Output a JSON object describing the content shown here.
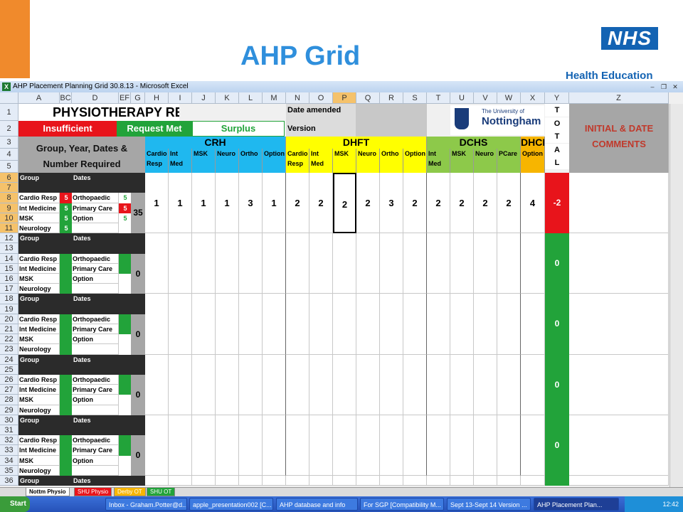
{
  "slide": {
    "title": "AHP Grid",
    "nhs_logo": "NHS",
    "nhs_subtitle": "Health Education"
  },
  "window": {
    "title": "AHP Placement Planning Grid 30.8.13 - Microsoft Excel"
  },
  "columns": [
    "A",
    "BC",
    "D",
    "EF",
    "G",
    "H",
    "I",
    "J",
    "K",
    "L",
    "M",
    "N",
    "O",
    "P",
    "Q",
    "R",
    "S",
    "T",
    "U",
    "V",
    "W",
    "X",
    "Y",
    "Z"
  ],
  "rows": [
    "1",
    "2",
    "3",
    "4",
    "5",
    "6",
    "7",
    "8",
    "9",
    "10",
    "11",
    "12",
    "13",
    "14",
    "15",
    "16",
    "17",
    "18",
    "19",
    "20",
    "21",
    "22",
    "23",
    "24",
    "25",
    "26",
    "27",
    "28",
    "29",
    "30",
    "31",
    "32",
    "33",
    "34",
    "35",
    "36"
  ],
  "header": {
    "physio_requests": "PHYSIOTHERAPY REQUESTS",
    "date_amended": "Date amended",
    "version": "Version",
    "insufficient": "Insufficient",
    "request_met": "Request Met",
    "surplus": "Surplus",
    "group_label": "Group, Year, Dates & Number Required",
    "uni_small": "The University of",
    "uni_big": "Nottingham",
    "total": [
      "T",
      "O",
      "T",
      "A",
      "L"
    ],
    "comments": "INITIAL & DATE COMMENTS",
    "crh": "CRH",
    "dhft": "DHFT",
    "dchs": "DCHS",
    "dhcft": "DHCFT"
  },
  "subcols": {
    "crh": [
      [
        "Cardio",
        "Resp"
      ],
      [
        "Int",
        "Med"
      ],
      [
        "",
        "MSK"
      ],
      [
        "",
        "Neuro"
      ],
      [
        "",
        "Ortho"
      ],
      [
        "",
        "Option"
      ]
    ],
    "dhft": [
      [
        "Cardio",
        "Resp"
      ],
      [
        "Int",
        "Med"
      ],
      [
        "",
        "MSK"
      ],
      [
        "",
        "Neuro"
      ],
      [
        "",
        "Ortho"
      ],
      [
        "",
        "Option"
      ]
    ],
    "dchs": [
      [
        "Int",
        "Med"
      ],
      [
        "",
        "MSK"
      ],
      [
        "",
        "Neuro"
      ],
      [
        "",
        "PCare"
      ]
    ],
    "dhcft": [
      [
        "",
        "Option"
      ]
    ]
  },
  "block1": {
    "group": "Group",
    "dates": "Dates",
    "left": [
      {
        "label": "Cardio Resp",
        "num": "5",
        "color": "#e8141b"
      },
      {
        "label": "Int Medicine",
        "num": "5",
        "color": "#22a33a"
      },
      {
        "label": "MSK",
        "num": "5",
        "color": "#22a33a"
      },
      {
        "label": "Neurology",
        "num": "5",
        "color": "#22a33a"
      }
    ],
    "right": [
      {
        "label": "Orthopaedic",
        "num": "5",
        "color": "#ffffff",
        "numcolor": "#22a33a"
      },
      {
        "label": "Primary Care",
        "num": "5",
        "color": "#e8141b",
        "numcolor": "#ffffff"
      },
      {
        "label": "Option",
        "num": "5",
        "color": "#ffffff",
        "numcolor": "#22a33a"
      }
    ],
    "count": "35",
    "values": [
      "1",
      "1",
      "1",
      "1",
      "3",
      "1",
      "2",
      "2",
      "2",
      "2",
      "3",
      "2",
      "2",
      "2",
      "2",
      "2",
      "4"
    ],
    "total": "-2"
  },
  "blocks": [
    {
      "group": "Group",
      "dates": "Dates",
      "left": [
        "Cardio Resp",
        "Int Medicine",
        "MSK",
        "Neurology"
      ],
      "right": [
        "Orthopaedic",
        "Primary Care",
        "Option"
      ],
      "count": "0",
      "total": "0"
    },
    {
      "group": "Group",
      "dates": "Dates",
      "left": [
        "Cardio Resp",
        "Int Medicine",
        "MSK",
        "Neurology"
      ],
      "right": [
        "Orthopaedic",
        "Primary Care",
        "Option"
      ],
      "count": "0",
      "total": "0"
    },
    {
      "group": "Group",
      "dates": "Dates",
      "left": [
        "Cardio Resp",
        "Int Medicine",
        "MSK",
        "Neurology"
      ],
      "right": [
        "Orthopaedic",
        "Primary Care",
        "Option"
      ],
      "count": "0",
      "total": "0"
    },
    {
      "group": "Group",
      "dates": "Dates",
      "left": [
        "Cardio Resp",
        "Int Medicine",
        "MSK",
        "Neurology"
      ],
      "right": [
        "Orthopaedic",
        "Primary Care",
        "Option"
      ],
      "count": "0",
      "total": "0"
    }
  ],
  "last_row": {
    "group": "Group",
    "dates": "Dates"
  },
  "sheet_tabs": [
    "Nottm Physio",
    "SHU Physio",
    "Derby OT",
    "SHU OT"
  ],
  "taskbar": {
    "start": "Start",
    "items": [
      "Inbox - Graham.Potter@d...",
      "apple_presentation002 [C...",
      "AHP database and info",
      "For SGP [Compatibility M...",
      "Sept 13-Sept 14 Version ...",
      "AHP Placement Plan..."
    ],
    "clock": "12:42"
  },
  "colors": {
    "crh": "#1fb8ef",
    "dhft": "#ffff00",
    "dchs": "#8dc94a",
    "dhcft": "#f7b500",
    "red": "#e8141b",
    "green": "#22a33a",
    "grey": "#a6a6a6",
    "title_blue": "#2f8fdc"
  }
}
